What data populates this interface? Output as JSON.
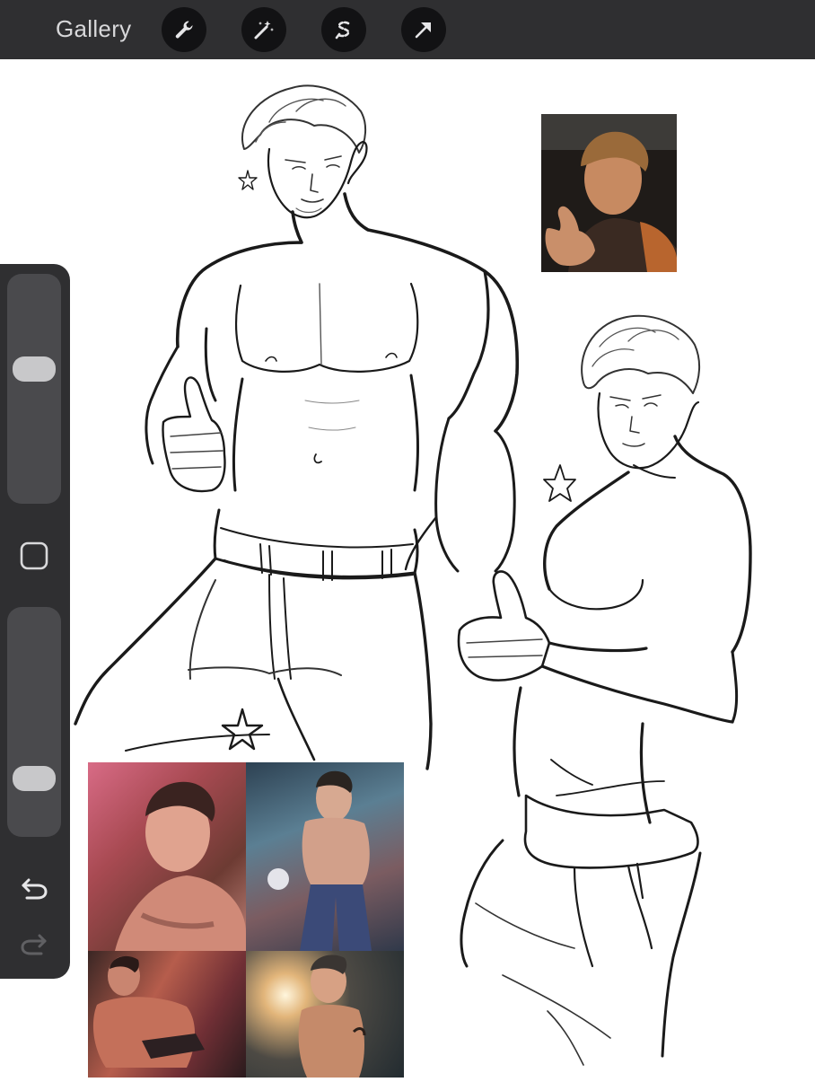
{
  "toolbar": {
    "gallery_label": "Gallery",
    "tools": [
      "wrench-icon",
      "magic-wand-icon",
      "selection-s-icon",
      "transform-arrow-icon"
    ]
  },
  "sidebar": {
    "brush_size_level": 0.6,
    "opacity_level": 0.21,
    "controls": [
      "square-modify-icon",
      "undo-icon",
      "redo-icon"
    ]
  },
  "canvas": {
    "background": "#ffffff",
    "items": [
      "sketch-man-thumbs-up-left",
      "sketch-man-thumbs-up-right",
      "reference-photo-top-right",
      "reference-photo-collage"
    ]
  },
  "colors": {
    "toolbar_bg": "#2f2f31",
    "tool_button_bg": "#121214",
    "slider_track": "#4a4a4d",
    "slider_knob": "#c8c8ca"
  }
}
